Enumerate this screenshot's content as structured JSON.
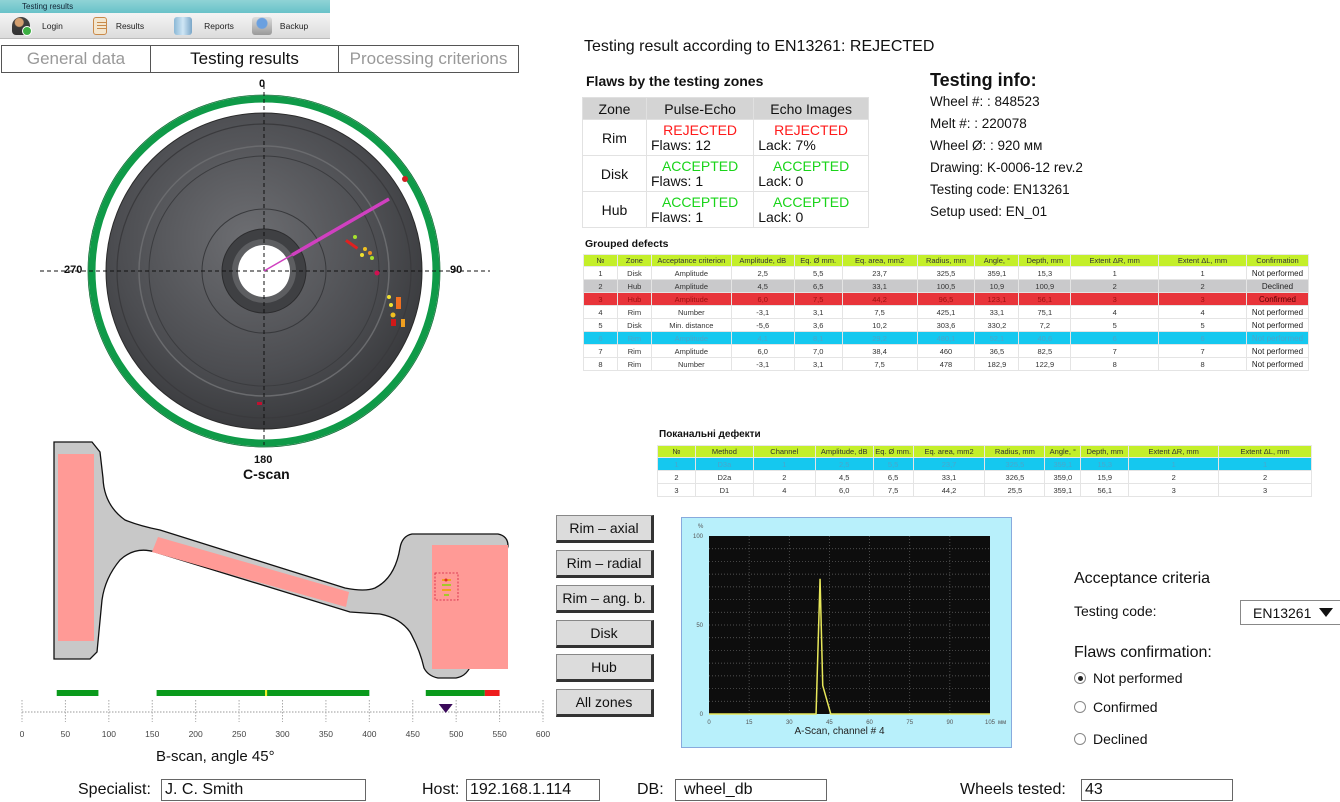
{
  "window": {
    "title": "Testing results"
  },
  "toolbar": [
    {
      "label": "Login",
      "icon": "user-login-icon"
    },
    {
      "label": "Results",
      "icon": "clipboard-icon"
    },
    {
      "label": "Reports",
      "icon": "books-icon"
    },
    {
      "label": "Backup",
      "icon": "backup-drive-icon"
    }
  ],
  "tabs": [
    {
      "label": "General data",
      "active": false
    },
    {
      "label": "Testing results",
      "active": true
    },
    {
      "label": "Processing criterions",
      "active": false
    }
  ],
  "cscan": {
    "title": "C-scan",
    "angle_labels": {
      "top": "0",
      "right": "90",
      "bottom": "180",
      "left": "270"
    },
    "colors": {
      "ring": "#0f9a48",
      "wheel": "#505154",
      "beam": "#d040c0"
    }
  },
  "bscan": {
    "title": "B-scan, angle 45°",
    "axis_ticks": [
      "0",
      "50",
      "100",
      "150",
      "200",
      "250",
      "300",
      "350",
      "400",
      "450",
      "500",
      "550",
      "600"
    ],
    "coverage_segments": [
      {
        "from": 40,
        "to": 88,
        "status": "ok"
      },
      {
        "from": 155,
        "to": 280,
        "status": "ok"
      },
      {
        "from": 282,
        "to": 400,
        "status": "ok"
      },
      {
        "from": 465,
        "to": 533,
        "status": "ok"
      },
      {
        "from": 533,
        "to": 550,
        "status": "fail"
      }
    ],
    "marker_position": 488,
    "colors": {
      "ok": "#0a9a1c",
      "fail": "#ee1c1c",
      "zone": "#ff9a96",
      "profile": "#c8c8c8"
    }
  },
  "result": {
    "title": "Testing result according to EN13261: REJECTED",
    "zones_title": "Flaws by the testing zones",
    "zones_headers": [
      "Zone",
      "Pulse-Echo",
      "Echo Images"
    ],
    "zones": [
      {
        "zone": "Rim",
        "pe_status": "REJECTED",
        "pe_detail": "Flaws: 12",
        "ei_status": "REJECTED",
        "ei_detail": "Lack: 7%"
      },
      {
        "zone": "Disk",
        "pe_status": "ACCEPTED",
        "pe_detail": "Flaws: 1",
        "ei_status": "ACCEPTED",
        "ei_detail": "Lack: 0"
      },
      {
        "zone": "Hub",
        "pe_status": "ACCEPTED",
        "pe_detail": "Flaws: 1",
        "ei_status": "ACCEPTED",
        "ei_detail": "Lack: 0"
      }
    ]
  },
  "info": {
    "title": "Testing info:",
    "lines": [
      "Wheel #:  : 848523",
      "Melt #:  : 220078",
      "Wheel Ø:  : 920 мм",
      "Drawing: K-0006-12 rev.2",
      "Testing code: EN13261",
      "Setup used: EN_01"
    ]
  },
  "grouped": {
    "title": "Grouped defects",
    "headers": [
      "№",
      "Zone",
      "Acceptance criterion",
      "Amplitude, dB",
      "Eq. Ø mm.",
      "Eq. area, mm2",
      "Radius, mm",
      "Angle, °",
      "Depth, mm",
      "Extent ΔR, mm",
      "Extent ΔL, mm",
      "Confirmation"
    ],
    "rows": [
      {
        "style": "",
        "cells": [
          "1",
          "Disk",
          "Amplitude",
          "2,5",
          "5,5",
          "23,7",
          "325,5",
          "359,1",
          "15,3",
          "1",
          "1",
          "Not performed"
        ]
      },
      {
        "style": "gray",
        "cells": [
          "2",
          "Hub",
          "Amplitude",
          "4,5",
          "6,5",
          "33,1",
          "100,5",
          "10,9",
          "100,9",
          "2",
          "2",
          "Declined"
        ]
      },
      {
        "style": "red",
        "cells": [
          "3",
          "Hub",
          "Amplitude",
          "6,0",
          "7,5",
          "44,2",
          "96,5",
          "123,1",
          "56,1",
          "3",
          "3",
          "Confirmed"
        ]
      },
      {
        "style": "",
        "cells": [
          "4",
          "Rim",
          "Number",
          "-3,1",
          "3,1",
          "7,5",
          "425,1",
          "33,1",
          "75,1",
          "4",
          "4",
          "Not performed"
        ]
      },
      {
        "style": "",
        "cells": [
          "5",
          "Disk",
          "Min. distance",
          "-5,6",
          "3,6",
          "10,2",
          "303,6",
          "330,2",
          "7,2",
          "5",
          "5",
          "Not performed"
        ]
      },
      {
        "style": "cyan",
        "cells": [
          "6",
          "Rim",
          "Amplitude",
          "4,1",
          "8,1",
          "29,2",
          "480,1",
          "52,1",
          "40,6",
          "6",
          "6",
          "Not performed"
        ]
      },
      {
        "style": "",
        "cells": [
          "7",
          "Rim",
          "Amplitude",
          "6,0",
          "7,0",
          "38,4",
          "460",
          "36,5",
          "82,5",
          "7",
          "7",
          "Not performed"
        ]
      },
      {
        "style": "",
        "cells": [
          "8",
          "Rim",
          "Number",
          "-3,1",
          "3,1",
          "7,5",
          "478",
          "182,9",
          "122,9",
          "8",
          "8",
          "Not performed"
        ]
      }
    ]
  },
  "locals": {
    "title": "Поканальні дефекти",
    "headers": [
      "№",
      "Method",
      "Channel",
      "Amplitude, dB",
      "Eq. Ø mm.",
      "Eq. area, mm2",
      "Radius, mm",
      "Angle, °",
      "Depth, mm",
      "Extent ΔR, mm",
      "Extent ΔL, mm"
    ],
    "rows": [
      {
        "style": "cyan",
        "cells": [
          "1",
          "D3a",
          "1",
          "2,5",
          "5,5",
          "23,7",
          "325,5",
          "359,1",
          "15,3",
          "1",
          "1"
        ]
      },
      {
        "style": "",
        "cells": [
          "2",
          "D2a",
          "2",
          "4,5",
          "6,5",
          "33,1",
          "326,5",
          "359,0",
          "15,9",
          "2",
          "2"
        ]
      },
      {
        "style": "",
        "cells": [
          "3",
          "D1",
          "4",
          "6,0",
          "7,5",
          "44,2",
          "25,5",
          "359,1",
          "56,1",
          "3",
          "3"
        ]
      }
    ]
  },
  "zone_buttons": [
    "Rim – axial",
    "Rim – radial",
    "Rim – ang. b.",
    "Disk",
    "Hub",
    "All zones"
  ],
  "chart_data": {
    "type": "line",
    "title": "A-Scan, channel # 4",
    "xlabel": "мм",
    "ylabel": "%",
    "xlim": [
      0,
      105
    ],
    "ylim": [
      0,
      100
    ],
    "x_ticks": [
      "0",
      "15",
      "30",
      "45",
      "60",
      "75",
      "90",
      "105"
    ],
    "y_ticks": [
      "0",
      "50",
      "100"
    ],
    "grid": true,
    "series": [
      {
        "name": "A-scan",
        "color": "#e8e85a",
        "x": [
          0,
          40,
          41.5,
          42.5,
          45.5,
          105
        ],
        "y": [
          0,
          0,
          76,
          16,
          0,
          0
        ]
      }
    ]
  },
  "acceptance": {
    "title": "Acceptance criteria",
    "testing_code_label": "Testing code:",
    "testing_code_value": "EN13261",
    "confirm_title": "Flaws confirmation:",
    "options": [
      {
        "label": "Not performed",
        "checked": true
      },
      {
        "label": "Confirmed",
        "checked": false
      },
      {
        "label": "Declined",
        "checked": false
      }
    ]
  },
  "footer": {
    "specialist_label": "Specialist:",
    "specialist_value": "J. C. Smith",
    "host_label": "Host:",
    "host_value": "192.168.1.114",
    "db_label": "DB:",
    "db_value": "wheel_db",
    "wheels_label": "Wheels tested:",
    "wheels_value": "43"
  }
}
